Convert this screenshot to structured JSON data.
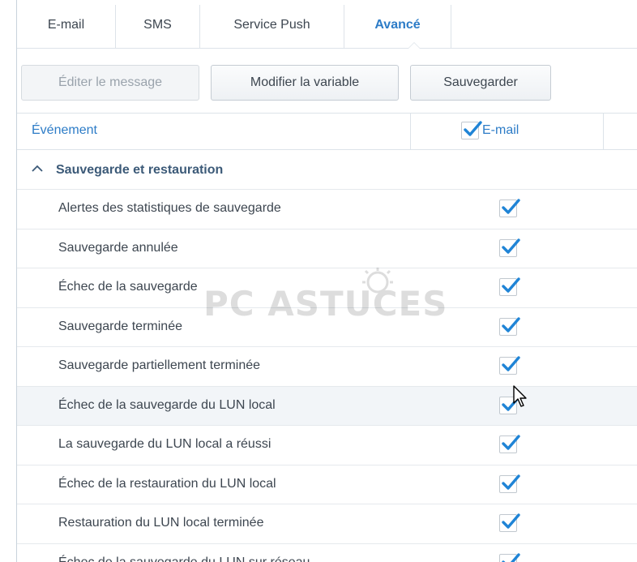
{
  "tabs": [
    {
      "label": "E-mail"
    },
    {
      "label": "SMS"
    },
    {
      "label": "Service Push"
    },
    {
      "label": "Avancé",
      "active": true
    }
  ],
  "toolbar": {
    "edit_label": "Éditer le message",
    "modify_label": "Modifier la variable",
    "save_label": "Sauvegarder"
  },
  "table": {
    "col_event": "Événement",
    "col_email": "E-mail",
    "col_email_checked": true
  },
  "group": {
    "label": "Sauvegarde et restauration",
    "expanded": true
  },
  "events": [
    {
      "label": "Alertes des statistiques de sauvegarde",
      "email": true
    },
    {
      "label": "Sauvegarde annulée",
      "email": true
    },
    {
      "label": "Échec de la sauvegarde",
      "email": true
    },
    {
      "label": "Sauvegarde terminée",
      "email": true
    },
    {
      "label": "Sauvegarde partiellement terminée",
      "email": true
    },
    {
      "label": "Échec de la sauvegarde du LUN local",
      "email": true,
      "highlighted": true
    },
    {
      "label": "La sauvegarde du LUN local a réussi",
      "email": true
    },
    {
      "label": "Échec de la restauration du LUN local",
      "email": true
    },
    {
      "label": "Restauration du LUN local terminée",
      "email": true
    },
    {
      "label": "Échec de la sauvegarde du LUN sur réseau",
      "email": true
    }
  ],
  "watermark": {
    "text": "PC ASTUCES"
  },
  "colors": {
    "accent": "#2d7cc7",
    "check": "#1f84d6",
    "group_text": "#3c5a78"
  }
}
